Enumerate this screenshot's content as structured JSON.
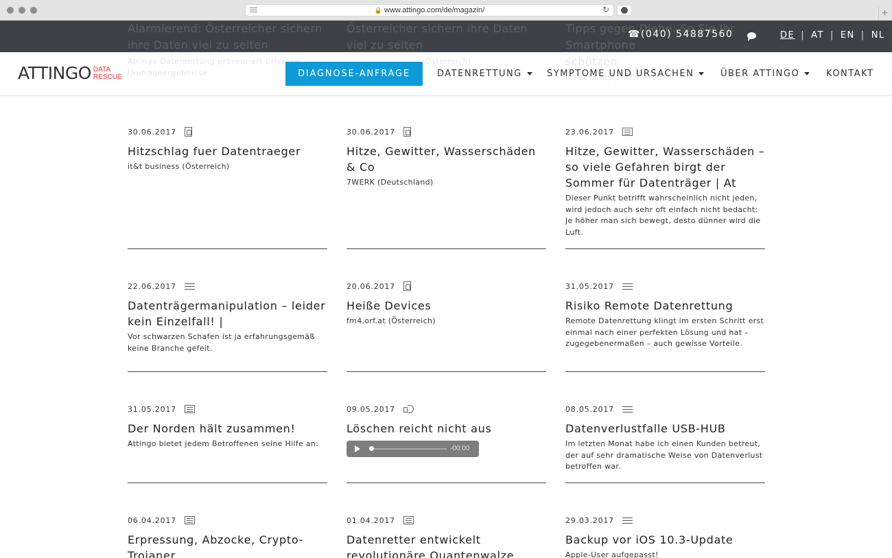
{
  "browser": {
    "url": "www.attingo.com/de/magazin/"
  },
  "topbar": {
    "phone": "(040) 54887560",
    "languages": [
      "DE",
      "AT",
      "EN",
      "NL"
    ],
    "active_language": "DE",
    "ghost_text": [
      "Alarmierend: Österreicher sichern",
      "ihre Daten viel zu selten",
      "Österreicher sichern ihre Daten",
      "viel zu selten",
      "Tipps gegen Diebe: So Sie Ihr",
      "Smartphone"
    ]
  },
  "navbar": {
    "logo_word": "ATTINGO",
    "logo_sub_1": "DATA",
    "logo_sub_2": "RESCUE",
    "diagnose_button": "DIAGNOSE-ANFRAGE",
    "items": [
      "DATENRETTUNG",
      "SYMPTOME UND URSACHEN",
      "ÜBER ATTINGO",
      "KONTAKT"
    ],
    "ghost_text": [
      "Attingo Datenrettung präsentiert brisante",
      "Umfrageergebnisse",
      "Österreich)",
      "schützen",
      "ict-at Lüdtplo (Österreich)"
    ]
  },
  "articles": [
    {
      "date": "30.06.2017",
      "icon": "pdf-icon",
      "title": "Hitzschlag fuer Datentraeger",
      "sub": "it&t business (Österreich)"
    },
    {
      "date": "30.06.2017",
      "icon": "pdf-icon",
      "title": "Hitze, Gewitter, Wasserschäden & Co",
      "sub": "7WERK (Deutschland)"
    },
    {
      "date": "23.06.2017",
      "icon": "news-icon",
      "title": "Hitze, Gewitter, Wasserschäden – so viele Gefahren birgt der Sommer für Datenträger | At",
      "sub": "Dieser Punkt betrifft wahrscheinlich nicht jeden, wird jedoch auch sehr oft einfach nicht bedacht: Je höher man sich bewegt, desto dünner wird die Luft."
    },
    {
      "date": "22.06.2017",
      "icon": "text-icon",
      "title": "Datenträgermanipulation – leider kein Einzelfall! |",
      "sub": "Vor schwarzen Schafen ist ja erfahrungsgemäß keine Branche gefeit."
    },
    {
      "date": "20.06.2017",
      "icon": "pdf-icon",
      "title": "Heiße Devices",
      "sub": "fm4.orf.at (Österreich)"
    },
    {
      "date": "31.05.2017",
      "icon": "text-icon",
      "title": "Risiko Remote Datenrettung",
      "sub": "Remote Datenrettung klingt im ersten Schritt erst einmal nach einer perfekten Lösung und hat – zugegebenermaßen – auch gewisse Vorteile."
    },
    {
      "date": "31.05.2017",
      "icon": "news-icon",
      "title": "Der Norden hält zusammen!",
      "sub": "Attingo bietet jedem Betroffenen seine Hilfe an:"
    },
    {
      "date": "09.05.2017",
      "icon": "audio-icon",
      "title": "Löschen reicht nicht aus",
      "sub": ""
    },
    {
      "date": "08.05.2017",
      "icon": "text-icon",
      "title": "Datenverlustfalle USB-HUB",
      "sub": "Im letzten Monat habe ich einen Kunden betreut, der auf sehr dramatische Weise von Datenverlust betroffen war."
    },
    {
      "date": "06.04.2017",
      "icon": "news-icon",
      "title": "Erpressung, Abzocke, Crypto-Trojaner",
      "sub": ""
    },
    {
      "date": "01.04.2017",
      "icon": "news-icon",
      "title": "Datenretter entwickelt revolutionäre Quantenwalze",
      "sub": ""
    },
    {
      "date": "29.03.2017",
      "icon": "text-icon",
      "title": "Backup vor iOS 10.3-Update",
      "sub": "Apple-User aufgepasst!"
    }
  ],
  "audio_player": {
    "time": "-00:00",
    "progress": 0
  },
  "colors": {
    "accent": "#0e9ad7",
    "topbar": "#32353a",
    "logo_red": "#e4333b"
  }
}
